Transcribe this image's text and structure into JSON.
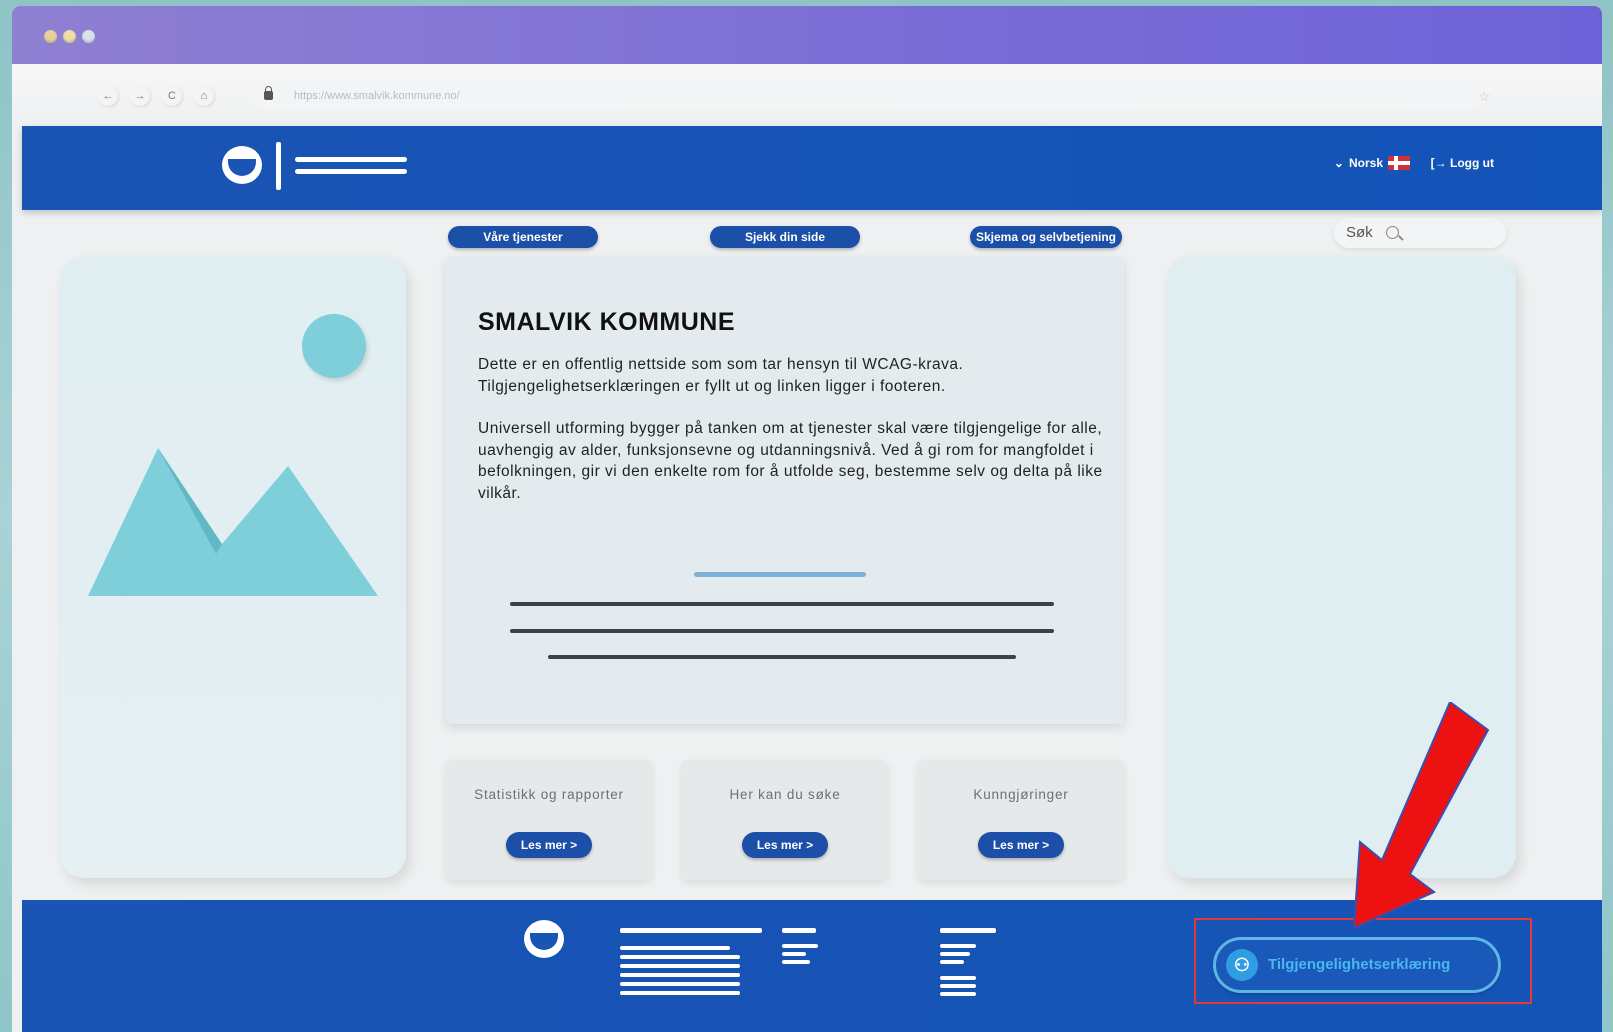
{
  "browser": {
    "url": "https://www.smalvik.kommune.no/",
    "nav_back": "←",
    "nav_forward": "→",
    "nav_reload": "C",
    "nav_home": "⌂",
    "bookmark_icon": "☆"
  },
  "header": {
    "language": "Norsk",
    "language_chevron": "⌄",
    "logout": "Logg ut",
    "logout_icon": "[→"
  },
  "nav": {
    "items": [
      {
        "label": "Våre tjenester"
      },
      {
        "label": "Sjekk din side"
      },
      {
        "label": "Skjema og selvbetjening"
      }
    ]
  },
  "search": {
    "label": "Søk"
  },
  "main": {
    "title": "SMALVIK KOMMUNE",
    "paragraph1": "Dette er en offentlig nettside som som tar hensyn til WCAG-krava. Tilgjengelighetserklæringen er fyllt ut og linken ligger i footeren.",
    "paragraph2": "Universell utforming bygger på tanken om at tjenester skal være tilgjengelige for alle, uavhengig av alder, funksjonsevne og utdanningsnivå. Ved å gi rom for mangfoldet i befolkningen, gir vi den enkelte rom for å utfolde seg, bestemme selv og delta på like vilkår."
  },
  "cards": [
    {
      "title": "Statistikk og rapporter",
      "button": "Les mer  >"
    },
    {
      "title": "Her kan du søke",
      "button": "Les mer  >"
    },
    {
      "title": "Kunngjøringer",
      "button": "Les mer  >"
    }
  ],
  "footer": {
    "accessibility_label": "Tilgjengelighetserklæring"
  },
  "colors": {
    "brand_blue": "#1a54b4",
    "highlight_red": "#e23a3a",
    "accent_cyan": "#48b8ee"
  }
}
